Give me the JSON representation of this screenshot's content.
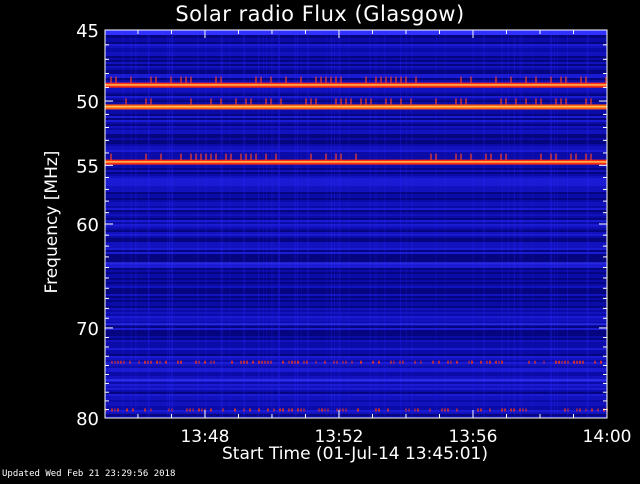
{
  "chart_data": {
    "type": "heatmap",
    "title": "Solar radio Flux (Glasgow)",
    "xlabel": "Start Time (01-Jul-14 13:45:01)",
    "ylabel": "Frequency [MHz]",
    "x_range": [
      "13:45:01",
      "14:00"
    ],
    "x_ticks": [
      "13:48",
      "13:52",
      "13:56",
      "14:00"
    ],
    "y_range_mhz": [
      45,
      80
    ],
    "y_scale": "log",
    "y_ticks": [
      45,
      50,
      55,
      60,
      70,
      80
    ],
    "colormap": [
      "#000066",
      "#1a1aff",
      "#ff3b1a",
      "#ffff66"
    ],
    "background_color": "#0a0a9e",
    "bright_bands_mhz": [
      {
        "freq": 48.8,
        "level": "very high"
      },
      {
        "freq": 50.4,
        "level": "high"
      },
      {
        "freq": 54.7,
        "level": "very high"
      },
      {
        "freq": 73.6,
        "level": "moderate"
      },
      {
        "freq": 79.0,
        "level": "moderate"
      }
    ]
  },
  "footer": {
    "updated": "Updated Wed Feb 21 23:29:56 2018"
  }
}
